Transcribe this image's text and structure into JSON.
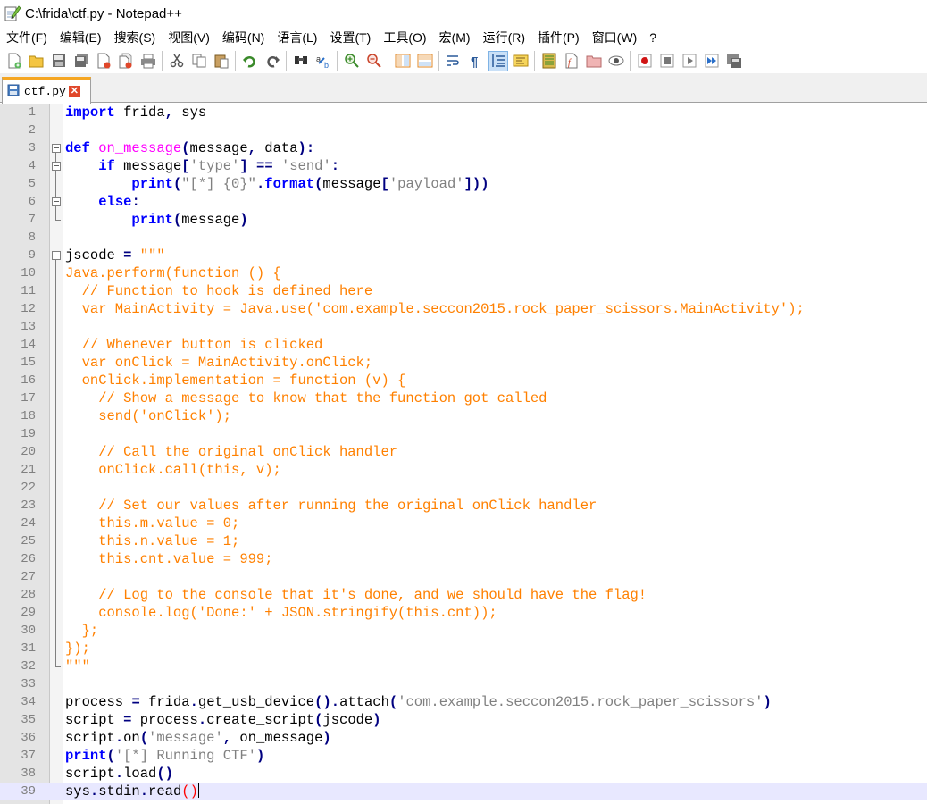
{
  "window": {
    "title": "C:\\frida\\ctf.py - Notepad++"
  },
  "menu": [
    "文件(F)",
    "编辑(E)",
    "搜索(S)",
    "视图(V)",
    "编码(N)",
    "语言(L)",
    "设置(T)",
    "工具(O)",
    "宏(M)",
    "运行(R)",
    "插件(P)",
    "窗口(W)",
    "?"
  ],
  "toolbar": [
    {
      "icon": "new-file-icon"
    },
    {
      "icon": "open-file-icon"
    },
    {
      "icon": "save-icon"
    },
    {
      "icon": "save-all-icon"
    },
    {
      "icon": "close-icon"
    },
    {
      "icon": "close-all-icon"
    },
    {
      "icon": "print-icon"
    },
    {
      "icon": "cut-icon"
    },
    {
      "icon": "copy-icon"
    },
    {
      "icon": "paste-icon"
    },
    {
      "icon": "undo-icon"
    },
    {
      "icon": "redo-icon"
    },
    {
      "icon": "find-icon"
    },
    {
      "icon": "replace-icon"
    },
    {
      "icon": "zoom-in-icon"
    },
    {
      "icon": "zoom-out-icon"
    },
    {
      "icon": "sync-vertical-icon"
    },
    {
      "icon": "sync-horizontal-icon"
    },
    {
      "icon": "word-wrap-icon"
    },
    {
      "icon": "show-all-chars-icon"
    },
    {
      "icon": "indent-guide-icon"
    },
    {
      "icon": "language-icon"
    },
    {
      "icon": "doc-map-icon"
    },
    {
      "icon": "function-list-icon"
    },
    {
      "icon": "folder-workspace-icon"
    },
    {
      "icon": "monitoring-icon"
    },
    {
      "icon": "record-macro-icon"
    },
    {
      "icon": "stop-macro-icon"
    },
    {
      "icon": "play-macro-icon"
    },
    {
      "icon": "run-macro-multiple-icon"
    },
    {
      "icon": "save-macro-icon"
    }
  ],
  "tab": {
    "label": "ctf.py"
  },
  "editor": {
    "current_line": 39,
    "lines": [
      {
        "n": "1",
        "text": "import frida, sys"
      },
      {
        "n": "2",
        "text": ""
      },
      {
        "n": "3",
        "text": "def on_message(message, data):"
      },
      {
        "n": "4",
        "text": "    if message['type'] == 'send':"
      },
      {
        "n": "5",
        "text": "        print(\"[*] {0}\".format(message['payload']))"
      },
      {
        "n": "6",
        "text": "    else:"
      },
      {
        "n": "7",
        "text": "        print(message)"
      },
      {
        "n": "8",
        "text": ""
      },
      {
        "n": "9",
        "text": "jscode = \"\"\""
      },
      {
        "n": "10",
        "text": "Java.perform(function () {"
      },
      {
        "n": "11",
        "text": "  // Function to hook is defined here"
      },
      {
        "n": "12",
        "text": "  var MainActivity = Java.use('com.example.seccon2015.rock_paper_scissors.MainActivity');"
      },
      {
        "n": "13",
        "text": ""
      },
      {
        "n": "14",
        "text": "  // Whenever button is clicked"
      },
      {
        "n": "15",
        "text": "  var onClick = MainActivity.onClick;"
      },
      {
        "n": "16",
        "text": "  onClick.implementation = function (v) {"
      },
      {
        "n": "17",
        "text": "    // Show a message to know that the function got called"
      },
      {
        "n": "18",
        "text": "    send('onClick');"
      },
      {
        "n": "19",
        "text": ""
      },
      {
        "n": "20",
        "text": "    // Call the original onClick handler"
      },
      {
        "n": "21",
        "text": "    onClick.call(this, v);"
      },
      {
        "n": "22",
        "text": ""
      },
      {
        "n": "23",
        "text": "    // Set our values after running the original onClick handler"
      },
      {
        "n": "24",
        "text": "    this.m.value = 0;"
      },
      {
        "n": "25",
        "text": "    this.n.value = 1;"
      },
      {
        "n": "26",
        "text": "    this.cnt.value = 999;"
      },
      {
        "n": "27",
        "text": ""
      },
      {
        "n": "28",
        "text": "    // Log to the console that it's done, and we should have the flag!"
      },
      {
        "n": "29",
        "text": "    console.log('Done:' + JSON.stringify(this.cnt));"
      },
      {
        "n": "30",
        "text": "  };"
      },
      {
        "n": "31",
        "text": "});"
      },
      {
        "n": "32",
        "text": "\"\"\""
      },
      {
        "n": "33",
        "text": ""
      },
      {
        "n": "34",
        "text": "process = frida.get_usb_device().attach('com.example.seccon2015.rock_paper_scissors')"
      },
      {
        "n": "35",
        "text": "script = process.create_script(jscode)"
      },
      {
        "n": "36",
        "text": "script.on('message', on_message)"
      },
      {
        "n": "37",
        "text": "print('[*] Running CTF')"
      },
      {
        "n": "38",
        "text": "script.load()"
      },
      {
        "n": "39",
        "text": "sys.stdin.read()"
      }
    ]
  }
}
